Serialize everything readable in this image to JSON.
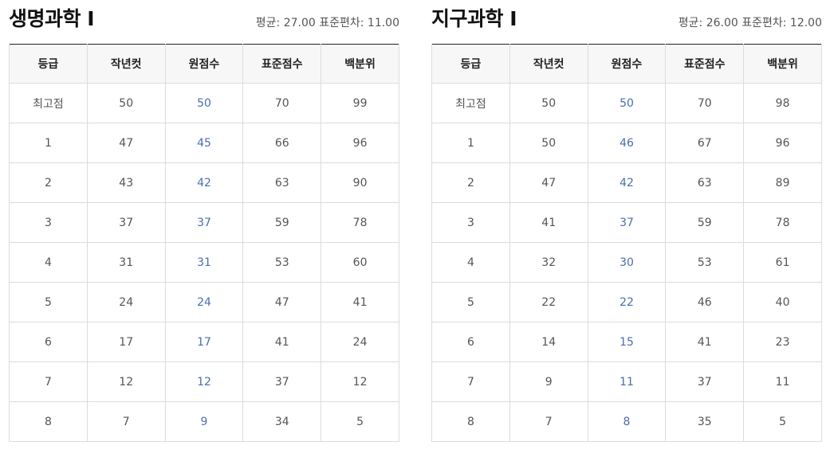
{
  "panels": [
    {
      "title": "생명과학 Ⅰ",
      "stats": "평균: 27.00 표준편차: 11.00",
      "headers": [
        "등급",
        "작년컷",
        "원점수",
        "표준점수",
        "백분위"
      ],
      "rows": [
        [
          "최고점",
          "50",
          "50",
          "70",
          "99"
        ],
        [
          "1",
          "47",
          "45",
          "66",
          "96"
        ],
        [
          "2",
          "43",
          "42",
          "63",
          "90"
        ],
        [
          "3",
          "37",
          "37",
          "59",
          "78"
        ],
        [
          "4",
          "31",
          "31",
          "53",
          "60"
        ],
        [
          "5",
          "24",
          "24",
          "47",
          "41"
        ],
        [
          "6",
          "17",
          "17",
          "41",
          "24"
        ],
        [
          "7",
          "12",
          "12",
          "37",
          "12"
        ],
        [
          "8",
          "7",
          "9",
          "34",
          "5"
        ]
      ]
    },
    {
      "title": "지구과학 Ⅰ",
      "stats": "평균: 26.00 표준편차: 12.00",
      "headers": [
        "등급",
        "작년컷",
        "원점수",
        "표준점수",
        "백분위"
      ],
      "rows": [
        [
          "최고점",
          "50",
          "50",
          "70",
          "98"
        ],
        [
          "1",
          "50",
          "46",
          "67",
          "96"
        ],
        [
          "2",
          "47",
          "42",
          "63",
          "89"
        ],
        [
          "3",
          "41",
          "37",
          "59",
          "78"
        ],
        [
          "4",
          "32",
          "30",
          "53",
          "61"
        ],
        [
          "5",
          "22",
          "22",
          "46",
          "40"
        ],
        [
          "6",
          "14",
          "15",
          "41",
          "23"
        ],
        [
          "7",
          "9",
          "11",
          "37",
          "11"
        ],
        [
          "8",
          "7",
          "8",
          "35",
          "5"
        ]
      ]
    }
  ],
  "colors": {
    "raw_score": "#4a6fb0",
    "header_bg": "#f7f7f7",
    "border": "#dcdcdc"
  }
}
